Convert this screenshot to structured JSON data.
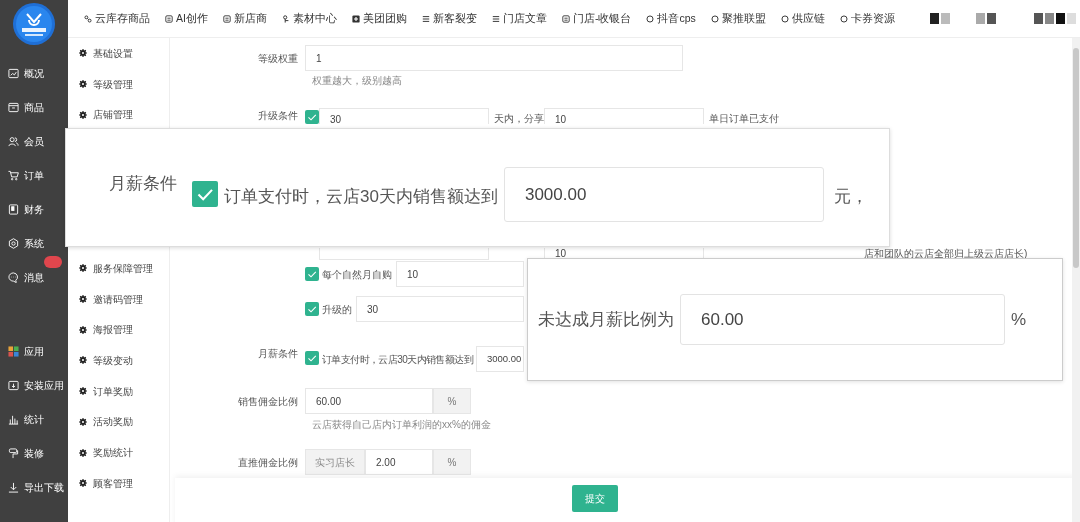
{
  "sidebar": {
    "items": [
      {
        "label": "概况",
        "kind": "chart"
      },
      {
        "label": "商品",
        "kind": "box"
      },
      {
        "label": "会员",
        "kind": "users"
      },
      {
        "label": "订单",
        "kind": "cart"
      },
      {
        "label": "财务",
        "kind": "book"
      },
      {
        "label": "系统",
        "kind": "gear"
      },
      {
        "label": "消息",
        "kind": "chat",
        "badge": true
      }
    ],
    "bottom_items": [
      {
        "label": "应用",
        "kind": "apps"
      },
      {
        "label": "安装应用",
        "kind": "install"
      },
      {
        "label": "统计",
        "kind": "bars"
      },
      {
        "label": "装修",
        "kind": "brush"
      },
      {
        "label": "导出下载",
        "kind": "download"
      }
    ]
  },
  "top_nav": [
    {
      "label": "云库存商品",
      "kind": "link"
    },
    {
      "label": "AI创作",
      "kind": "square"
    },
    {
      "label": "新店商",
      "kind": "square"
    },
    {
      "label": "素材中心",
      "kind": "branch"
    },
    {
      "label": "美团团购",
      "kind": "plus"
    },
    {
      "label": "新客裂变",
      "kind": "lines"
    },
    {
      "label": "门店文章",
      "kind": "lines"
    },
    {
      "label": "门店-收银台",
      "kind": "square"
    },
    {
      "label": "抖音cps",
      "kind": "ring"
    },
    {
      "label": "聚推联盟",
      "kind": "ring"
    },
    {
      "label": "供应链",
      "kind": "ring"
    },
    {
      "label": "卡券资源",
      "kind": "ring"
    }
  ],
  "submenu": {
    "items_top": [
      "基础设置",
      "等级管理",
      "店铺管理"
    ],
    "items_bottom": [
      "服务保障管理",
      "邀请码管理",
      "海报管理",
      "等级变动",
      "订单奖励",
      "活动奖励",
      "奖励统计",
      "顾客管理"
    ]
  },
  "form": {
    "weight": {
      "label": "等级权重",
      "value": "1",
      "hint": "权重越大，级别越高"
    },
    "upgrade": {
      "label": "升级条件",
      "checked": true,
      "value": "30",
      "text": "天内，分享",
      "value_2": "10",
      "text_2": "单日订单已支付"
    },
    "upgrade_row_2": {
      "value": "10",
      "text": "店和团队的云店全部归上级云店店长)"
    },
    "monthly_self": {
      "checked": true,
      "text": "每个自然月自购",
      "value": "10"
    },
    "upgraded": {
      "checked": true,
      "text": "升级的",
      "value": "30"
    },
    "salary": {
      "label": "月薪条件",
      "checked": true,
      "text": "订单支付时，云店30天内销售额达到",
      "value": "3000.00"
    },
    "sales_commission": {
      "label": "销售佣金比例",
      "value": "60.00",
      "unit": "%",
      "hint": "云店获得自己店内订单利润的xx%的佣金"
    },
    "direct_commission": {
      "label": "直推佣金比例",
      "prefix": "实习店长",
      "value": "2.00",
      "unit": "%"
    },
    "submit": "提交"
  },
  "zoom_salary": {
    "label": "月薪条件",
    "checked": true,
    "text": "订单支付时，云店30天内销售额达到",
    "value": "3000.00",
    "unit": "元，"
  },
  "zoom_ratio": {
    "label": "未达成月薪比例为",
    "value": "60.00",
    "unit": "%"
  }
}
